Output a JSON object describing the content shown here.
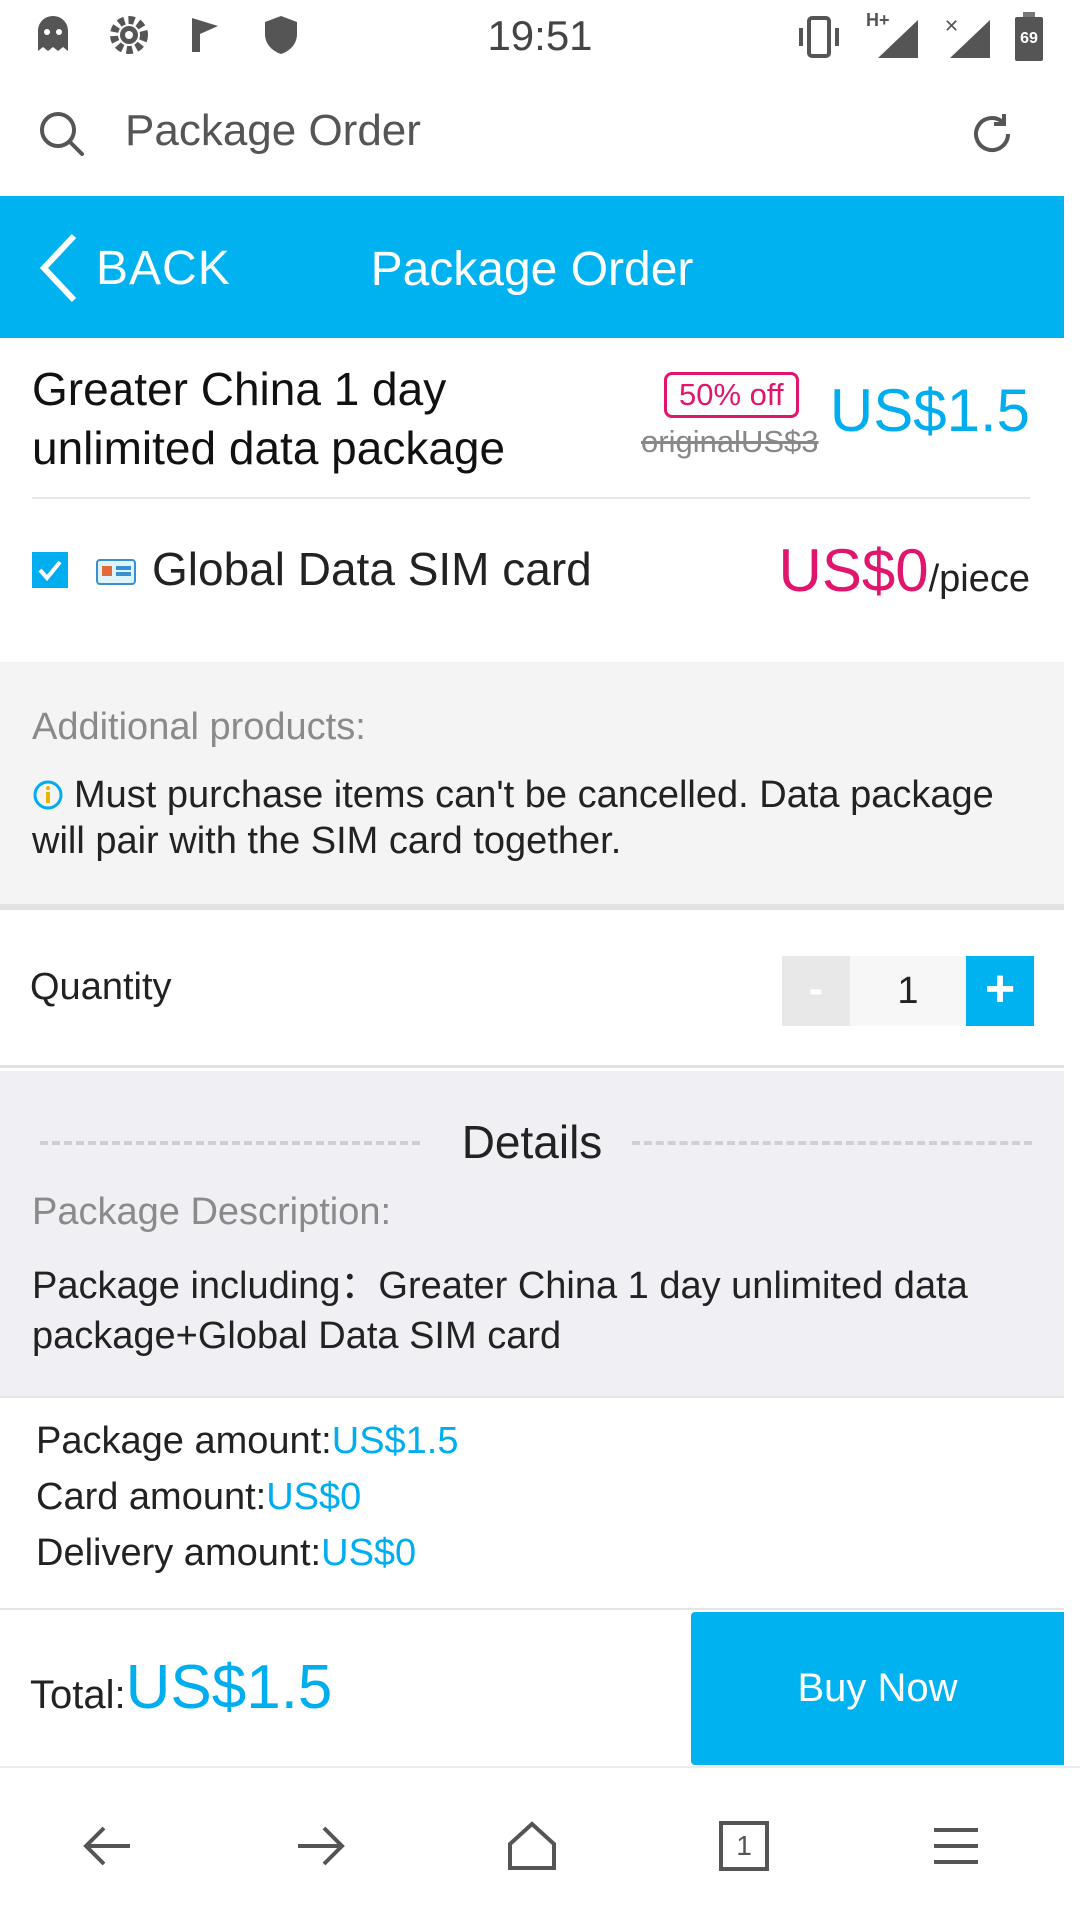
{
  "status_bar": {
    "time": "19:51",
    "network_label": "H+",
    "battery": "69",
    "left_icons": [
      "ghost-icon",
      "gear-icon",
      "flag-icon",
      "shield-icon"
    ],
    "right_icons": [
      "vibrate-icon",
      "signal-icon",
      "signal-x-icon",
      "battery-icon"
    ]
  },
  "address_bar": {
    "text": "Package Order",
    "left_icon": "search-icon",
    "right_icon": "reload-icon"
  },
  "header": {
    "back_label": "BACK",
    "title": "Package Order",
    "color": "#00b3f0"
  },
  "product": {
    "name": "Greater China 1 day unlimited data package",
    "discount_badge": "50% off",
    "original_price": "originalUS$3",
    "price": "US$1.5"
  },
  "sim_card": {
    "checked": true,
    "label": "Global Data SIM card",
    "price": "US$0",
    "unit": "/piece"
  },
  "additional": {
    "heading": "Additional products:",
    "note": "Must purchase items can't be cancelled. Data package will pair with the SIM card together."
  },
  "quantity": {
    "label": "Quantity",
    "minus_label": "-",
    "value": "1",
    "plus_label": "+"
  },
  "details": {
    "title": "Details",
    "description_label": "Package Description:",
    "description": "Package including：Greater China 1 day unlimited data package+Global Data SIM card"
  },
  "amounts": {
    "package_label": "Package amount:",
    "package_value": "US$1.5",
    "card_label": "Card amount:",
    "card_value": "US$0",
    "delivery_label": "Delivery amount:",
    "delivery_value": "US$0"
  },
  "footer": {
    "total_label": "Total:",
    "total_value": "US$1.5",
    "buy_label": "Buy Now"
  },
  "browser_nav": {
    "tab_count": "1",
    "icons": [
      "back-arrow-icon",
      "forward-arrow-icon",
      "home-icon",
      "tabs-icon",
      "menu-icon"
    ]
  },
  "colors": {
    "accent": "#00b3f0",
    "price_pink": "#e0166e",
    "price_blue": "#00aeef"
  }
}
